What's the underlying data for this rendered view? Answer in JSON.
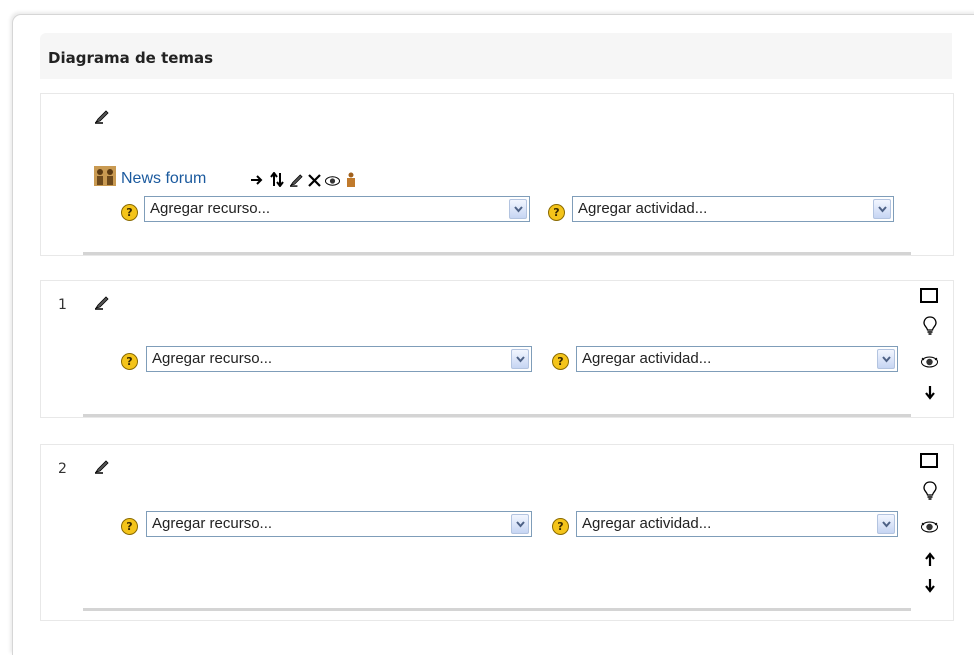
{
  "panel": {
    "title": "Diagrama de temas"
  },
  "sections": [
    {
      "id": "0",
      "number": "",
      "forum_link": "News forum",
      "resource_select": "Agregar recurso...",
      "activity_select": "Agregar actividad...",
      "help_glyph": "?"
    },
    {
      "id": "1",
      "number": "1",
      "resource_select": "Agregar recurso...",
      "activity_select": "Agregar actividad...",
      "help_glyph": "?",
      "side_icons": [
        "highlight-box-icon",
        "lightbulb-icon",
        "eye-icon",
        "arrow-down-icon"
      ]
    },
    {
      "id": "2",
      "number": "2",
      "resource_select": "Agregar recurso...",
      "activity_select": "Agregar actividad...",
      "help_glyph": "?",
      "side_icons": [
        "highlight-box-icon",
        "lightbulb-icon",
        "eye-icon",
        "arrow-up-icon",
        "arrow-down-icon"
      ]
    }
  ],
  "forum_actions": [
    "move-right-icon",
    "move-updown-icon",
    "edit-icon",
    "delete-icon",
    "eye-icon",
    "user-group-icon"
  ],
  "colors": {
    "link": "#1b5a9e",
    "help": "#f4c41a",
    "select_border": "#7f9db9",
    "header_bg": "#f6f6f6"
  }
}
